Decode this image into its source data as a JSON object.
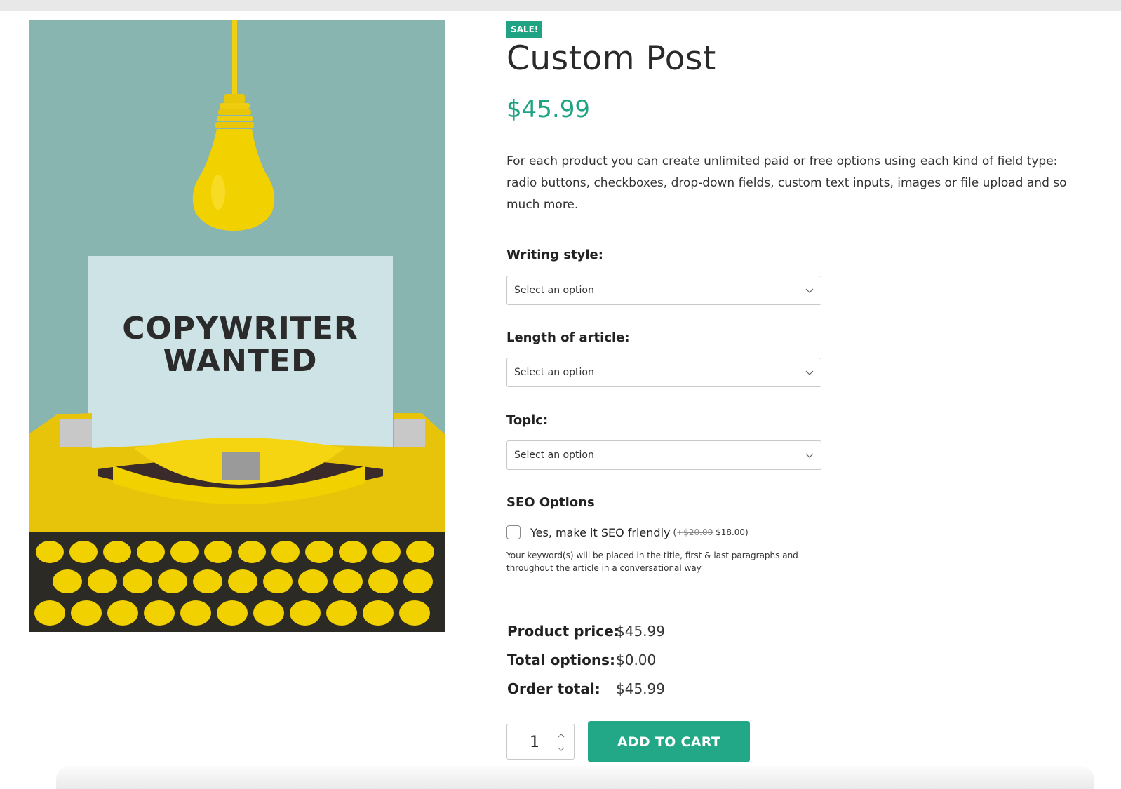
{
  "product": {
    "badge": "SALE!",
    "title": "Custom Post",
    "price": "$45.99",
    "description": "For each product you can create unlimited paid or free options using each kind of field type: radio buttons, checkboxes, drop-down fields, custom text inputs, images or file upload and so much more.",
    "image": {
      "line1": "COPYWRITER",
      "line2": "WANTED"
    }
  },
  "options": {
    "writing_style": {
      "label": "Writing style:",
      "value": "Select an option"
    },
    "length": {
      "label": "Length of article:",
      "value": "Select an option"
    },
    "topic": {
      "label": "Topic:",
      "value": "Select an option"
    },
    "seo": {
      "heading": "SEO Options",
      "checkbox_label": "Yes, make it SEO friendly",
      "price_prefix": "(+",
      "old_price": "$20.00",
      "new_price": "$18.00)",
      "checked": false,
      "help": "Your keyword(s) will be placed in the title, first & last paragraphs and throughout the article in a conversational way"
    }
  },
  "totals": {
    "product_price_label": "Product price:",
    "product_price": "$45.99",
    "total_options_label": "Total options:",
    "total_options": "$0.00",
    "order_total_label": "Order total:",
    "order_total": "$45.99"
  },
  "cart": {
    "quantity": "1",
    "button_label": "ADD TO CART"
  },
  "colors": {
    "accent": "#1fa383",
    "button": "#22a887",
    "image_bg": "#89b5b0",
    "bulb": "#f2d100"
  }
}
